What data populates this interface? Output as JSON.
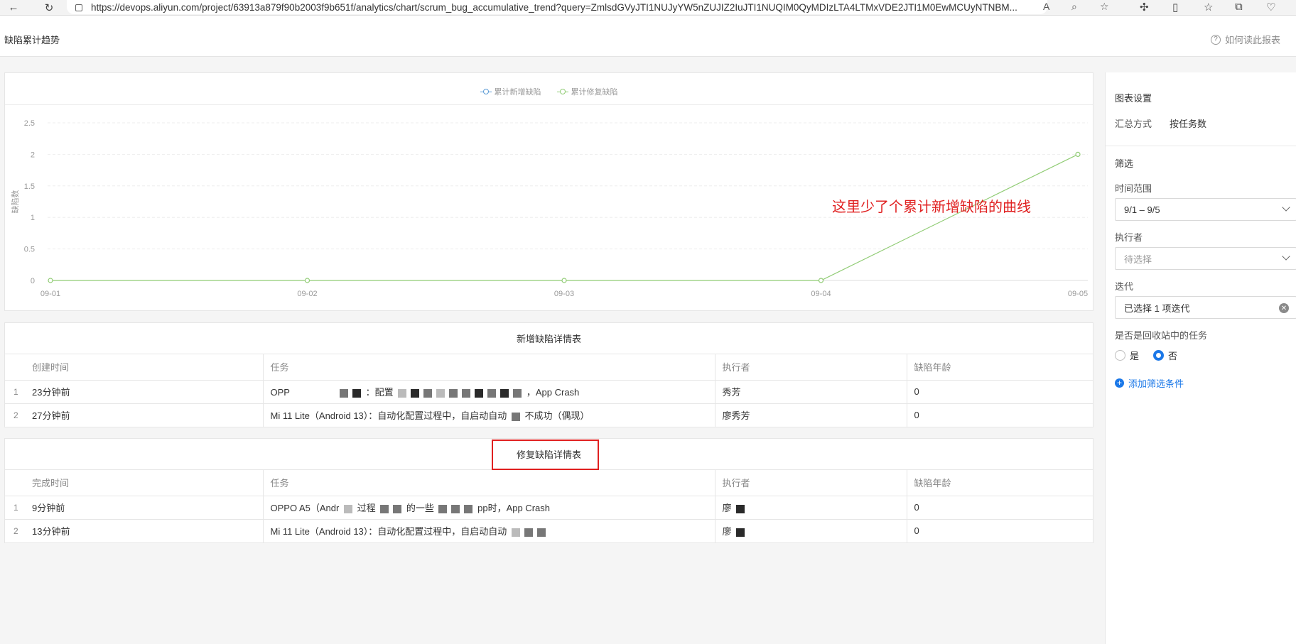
{
  "browser": {
    "url": "https://devops.aliyun.com/project/63913a879f90b2003f9b651f/analytics/chart/scrum_bug_accumulative_trend?query=ZmlsdGVyJTI1NUJyYW5nZUJIZ2IuJTI1NUQIM0QyMDIzLTA4LTMxVDE2JTI1M0EwMCUyNTNBM..."
  },
  "header": {
    "title": "缺陷累计趋势",
    "help_label": "如何读此报表"
  },
  "chart_data": {
    "type": "line",
    "categories": [
      "09-01",
      "09-02",
      "09-03",
      "09-04",
      "09-05"
    ],
    "series": [
      {
        "name": "累计新增缺陷",
        "color": "#5b9bd5",
        "values": []
      },
      {
        "name": "累计修复缺陷",
        "color": "#91cc75",
        "values": [
          0,
          0,
          0,
          0,
          2
        ]
      }
    ],
    "ylabel": "缺陷数",
    "yticks": [
      "0",
      "0.5",
      "1",
      "1.5",
      "2",
      "2.5"
    ],
    "ylim": [
      0,
      2.5
    ],
    "legend_position": "top-center",
    "grid": true
  },
  "annotation": "这里少了个累计新增缺陷的曲线",
  "new_table": {
    "title": "新增缺陷详情表",
    "headers": [
      "创建时间",
      "任务",
      "执行者",
      "缺陷年龄"
    ],
    "rows": [
      {
        "idx": "1",
        "time": "23分钟前",
        "task_start": "OPP",
        "task_mid": "：配置",
        "task_end": "，App Crash",
        "exec": "秀芳",
        "age": "0"
      },
      {
        "idx": "2",
        "time": "27分钟前",
        "task_start": "Mi 11 Lite（Android 13）：自动化配置过程中，自启动自动",
        "task_mid": "不成功（偶现）",
        "task_end": "",
        "exec": "廖秀芳",
        "age": "0"
      }
    ]
  },
  "fixed_table": {
    "title": "修复缺陷详情表",
    "headers": [
      "完成时间",
      "任务",
      "执行者",
      "缺陷年龄"
    ],
    "rows": [
      {
        "idx": "1",
        "time": "9分钟前",
        "task_start": "OPPO A5（Andr",
        "task_mid": "过程",
        "task_end": "的一些",
        "task_tail": "pp时，App Crash",
        "exec": "廖",
        "age": "0"
      },
      {
        "idx": "2",
        "time": "13分钟前",
        "task_start": "Mi 11 Lite（Android 13）：自动化配置过程中，自启动自动",
        "task_mid": "",
        "task_end": "",
        "task_tail": "",
        "exec": "廖",
        "age": "0"
      }
    ]
  },
  "panel": {
    "chart_settings": "图表设置",
    "summary_label": "汇总方式",
    "summary_value": "按任务数",
    "filter_title": "筛选",
    "time_range_label": "时间范围",
    "time_range_value": "9/1 – 9/5",
    "executor_label": "执行者",
    "executor_placeholder": "待选择",
    "iteration_label": "迭代",
    "iteration_value": "已选择 1 项迭代",
    "recycle_label": "是否是回收站中的任务",
    "radio_yes": "是",
    "radio_no": "否",
    "radio_selected": "否",
    "add_filter": "添加筛选条件"
  }
}
